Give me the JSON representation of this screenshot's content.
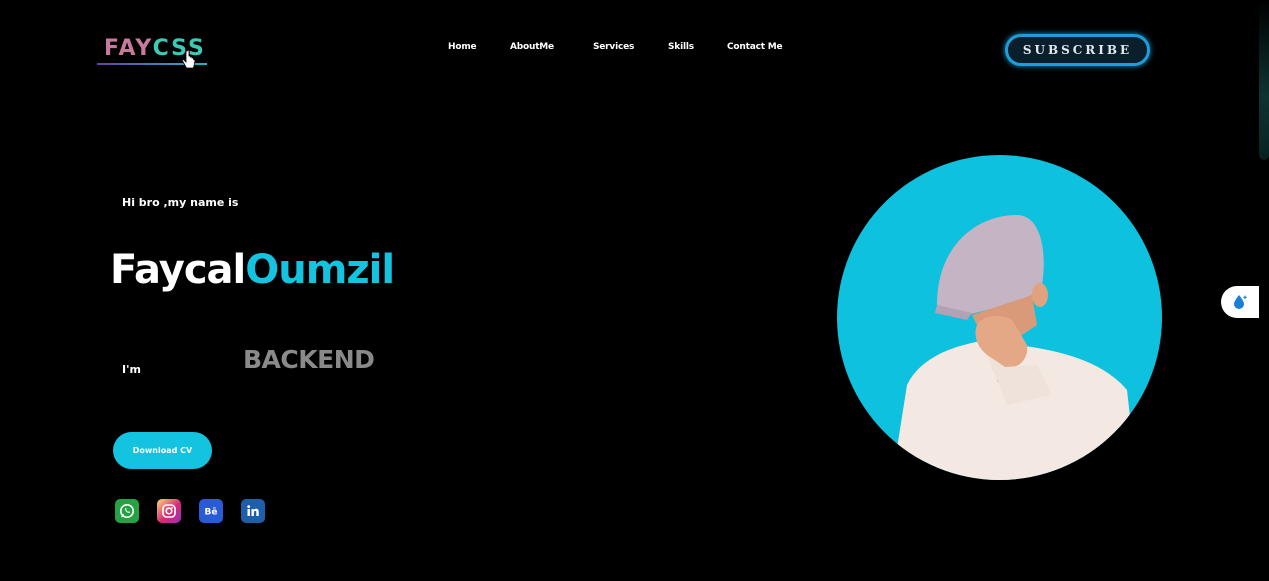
{
  "header": {
    "logo_part1": "FAY",
    "logo_part2": "CSS",
    "nav": [
      {
        "label": "Home"
      },
      {
        "label": "AboutMe"
      },
      {
        "label": "Services"
      },
      {
        "label": "Skills"
      },
      {
        "label": "Contact Me"
      }
    ],
    "subscribe_label": "SUBSCRIBE"
  },
  "hero": {
    "greeting": "Hi bro ,my name is",
    "first_name": "Faycal",
    "last_name": "Oumzil",
    "im_label": "I'm",
    "role": "BACKEND",
    "download_label": "Download CV"
  },
  "social": [
    {
      "icon": "whatsapp-icon"
    },
    {
      "icon": "instagram-icon"
    },
    {
      "icon": "behance-icon"
    },
    {
      "icon": "linkedin-icon"
    }
  ],
  "colors": {
    "background": "#000000",
    "accent": "#14c3e0",
    "subscribe_border": "#1d9ed8",
    "role_text": "#8a8a8a"
  }
}
